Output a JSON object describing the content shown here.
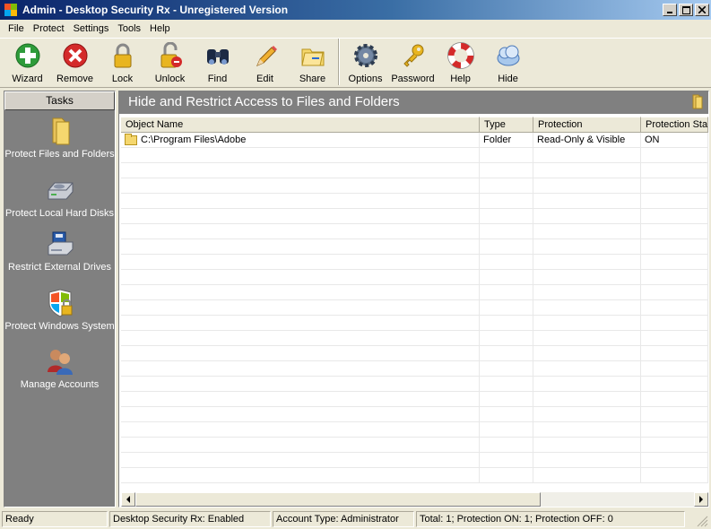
{
  "window": {
    "title": "Admin - Desktop Security Rx - Unregistered Version"
  },
  "menu": [
    "File",
    "Protect",
    "Settings",
    "Tools",
    "Help"
  ],
  "toolbar": {
    "group1": [
      {
        "label": "Wizard",
        "icon": "wizard-plus-icon"
      },
      {
        "label": "Remove",
        "icon": "remove-x-icon"
      },
      {
        "label": "Lock",
        "icon": "lock-icon"
      },
      {
        "label": "Unlock",
        "icon": "unlock-icon"
      },
      {
        "label": "Find",
        "icon": "binoculars-icon"
      },
      {
        "label": "Edit",
        "icon": "pencil-icon"
      },
      {
        "label": "Share",
        "icon": "share-folder-icon"
      }
    ],
    "group2": [
      {
        "label": "Options",
        "icon": "gear-icon"
      },
      {
        "label": "Password",
        "icon": "key-icon"
      },
      {
        "label": "Help",
        "icon": "lifebuoy-icon"
      },
      {
        "label": "Hide",
        "icon": "cloud-icon"
      }
    ]
  },
  "tasks": {
    "header": "Tasks",
    "items": [
      {
        "label": "Protect Files and Folders",
        "icon": "folder-icon"
      },
      {
        "label": "Protect Local Hard Disks",
        "icon": "hard-disk-icon"
      },
      {
        "label": "Restrict External Drives",
        "icon": "external-drive-icon"
      },
      {
        "label": "Protect Windows System",
        "icon": "windows-shield-lock-icon"
      },
      {
        "label": "Manage Accounts",
        "icon": "users-icon"
      }
    ]
  },
  "main": {
    "title": "Hide and Restrict Access to Files and Folders",
    "columns": [
      "Object Name",
      "Type",
      "Protection",
      "Protection Sta"
    ],
    "rows": [
      {
        "name": "C:\\Program Files\\Adobe",
        "type": "Folder",
        "protection": "Read-Only & Visible",
        "status": "ON"
      }
    ]
  },
  "status": {
    "state": "Ready",
    "app_state": "Desktop Security Rx: Enabled",
    "account": "Account Type: Administrator",
    "counts": "Total: 1;   Protection ON: 1;   Protection OFF: 0"
  },
  "colors": {
    "title_start": "#0a246a",
    "title_end": "#a6caf0",
    "panel_gray": "#808080",
    "chrome": "#ece9d8"
  }
}
